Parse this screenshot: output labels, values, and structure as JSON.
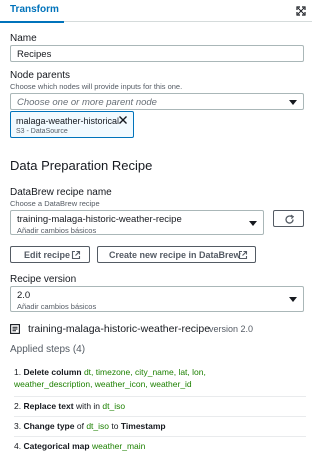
{
  "tabs": {
    "active": "Transform"
  },
  "name_field": {
    "label": "Name",
    "value": "Recipes"
  },
  "node_parents": {
    "label": "Node parents",
    "description": "Choose which nodes will provide inputs for this one.",
    "placeholder": "Choose one or more parent node",
    "token": {
      "title": "malaga-weather-historical",
      "subtitle": "S3 - DataSource"
    }
  },
  "section": {
    "title": "Data Preparation Recipe"
  },
  "databrew": {
    "label": "DataBrew recipe name",
    "description": "Choose a DataBrew recipe",
    "selected": "training-malaga-historic-weather-recipe",
    "selected_sub": "Añadir cambios básicos"
  },
  "buttons": {
    "edit_recipe": "Edit recipe",
    "create_recipe": "Create new recipe in DataBrew"
  },
  "recipe_version": {
    "label": "Recipe version",
    "selected": "2.0",
    "selected_sub": "Añadir cambios básicos"
  },
  "recipe_summary": {
    "name": "training-malaga-historic-weather-recipe",
    "version": "version 2.0",
    "applied_steps": "Applied steps (4)"
  },
  "steps": [
    {
      "num": "1.",
      "action": "Delete column",
      "columns_line1": "dt, timezone, city_name, lat, lon,",
      "columns_line2": "weather_description, weather_icon, weather_id"
    },
    {
      "num": "2.",
      "action": "Replace text",
      "mid": "with in",
      "column": "dt_iso"
    },
    {
      "num": "3.",
      "action": "Change type",
      "mid": "of",
      "column": "dt_iso",
      "mid2": "to",
      "target": "Timestamp"
    },
    {
      "num": "4.",
      "action": "Categorical map",
      "column": "weather_main"
    }
  ],
  "colors": {
    "accent": "#0073bb",
    "column_green": "#1d8102",
    "border": "#aab7b8"
  }
}
